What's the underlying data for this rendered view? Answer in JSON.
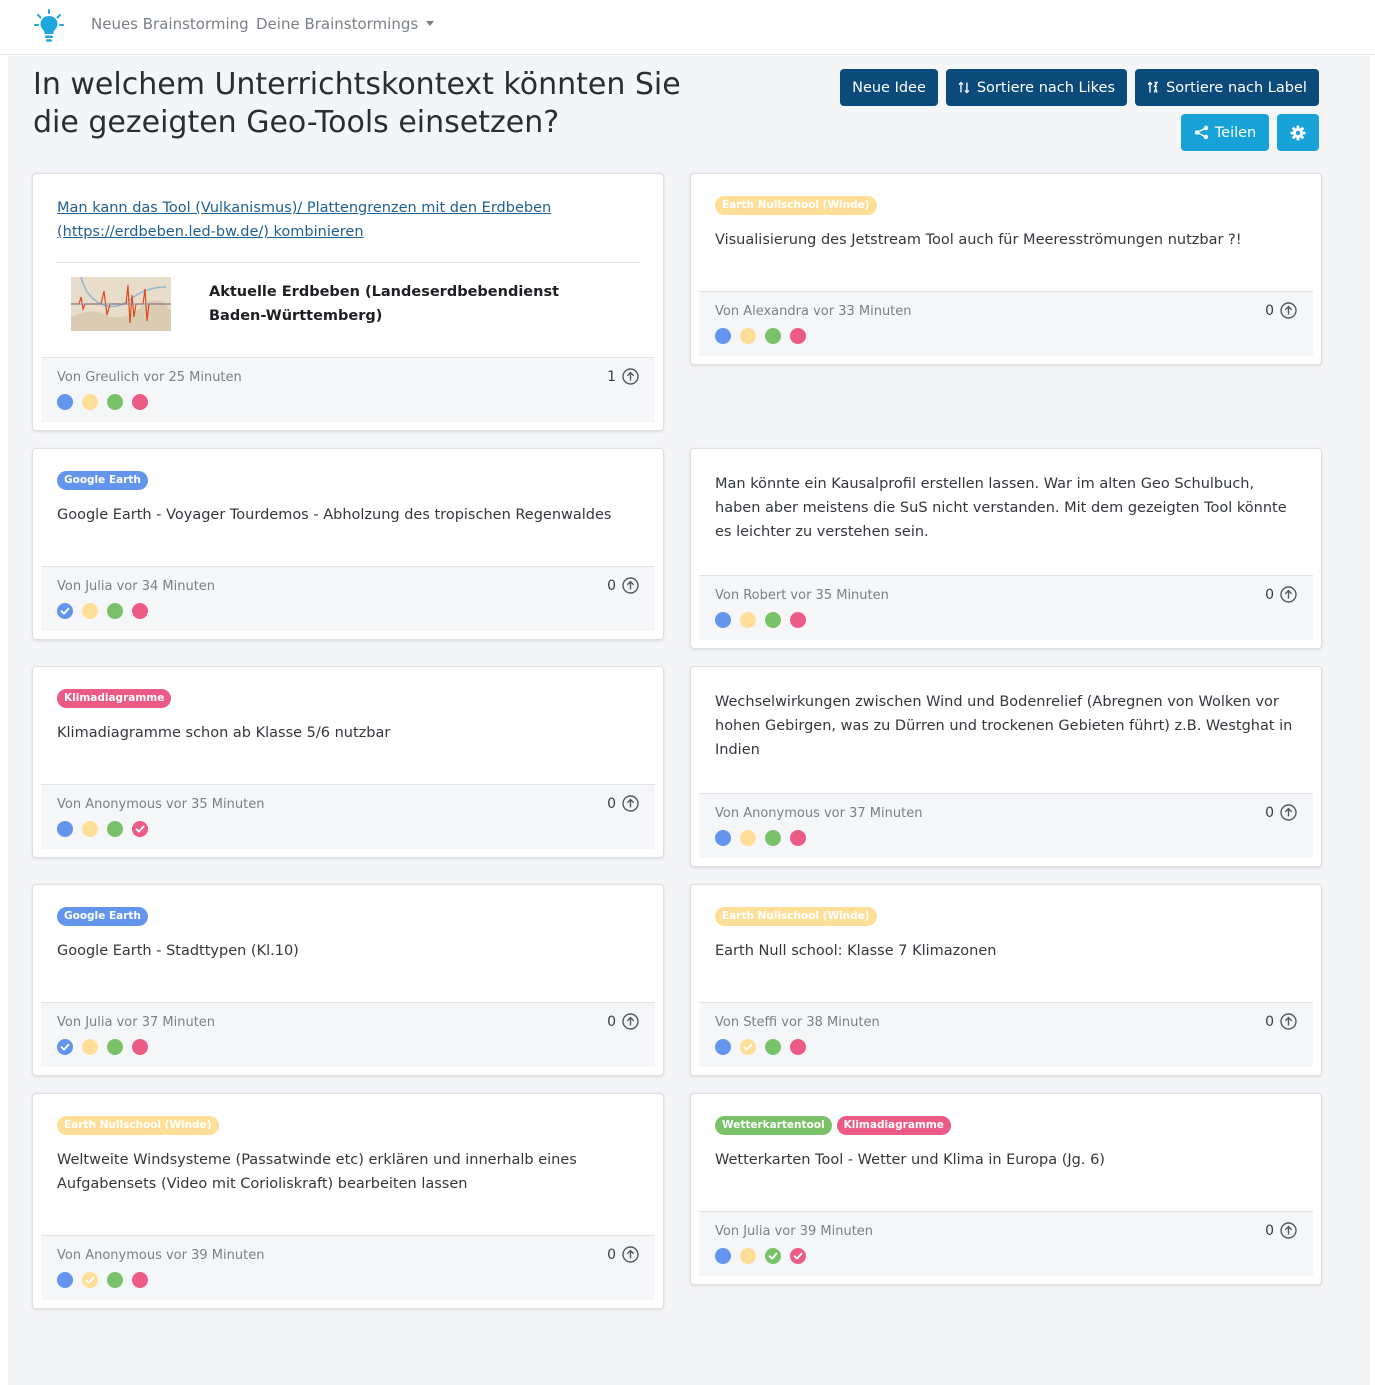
{
  "nav": {
    "new_brainstorming": "Neues Brainstorming",
    "my_brainstormings": "Deine Brainstormings"
  },
  "header": {
    "title": "In welchem Unterrichtskontext könnten Sie die gezeigten Geo-Tools einsetzen?",
    "new_idea": "Neue Idee",
    "sort_likes": "Sortiere nach Likes",
    "sort_label": "Sortiere nach Label",
    "share": "Teilen"
  },
  "colors": {
    "blue": "#6495ed",
    "yellow": "#ffdf97",
    "green": "#7ac26a",
    "pink": "#ec5a86",
    "tag_google_earth": "#6495ed",
    "tag_earth_nullschool": "#ffdf97",
    "tag_klimadiagramme": "#ec5a86",
    "tag_wetterkartentool": "#7ac26a",
    "button_dark": "#0b4a79",
    "button_cyan": "#17a2d8"
  },
  "cards": [
    {
      "tags": [],
      "text": "Man kann das Tool (Vulkanismus)/ Plattengrenzen mit den Erdbeben (https://erdbeben.led-bw.de/) kombinieren",
      "preview_title": "Aktuelle Erdbeben (Landeserdbebendienst Baden-Württemberg)",
      "author": "Von Greulich vor 25 Minuten",
      "likes": "1",
      "checked": [
        false,
        false,
        false,
        false
      ]
    },
    {
      "tags": [
        "Earth Nullschool (Winde)"
      ],
      "text": "Visualisierung des Jetstream Tool auch für Meeresströmungen nutzbar ?!",
      "author": "Von Alexandra vor 33 Minuten",
      "likes": "0",
      "checked": [
        false,
        false,
        false,
        false
      ]
    },
    {
      "tags": [
        "Google Earth"
      ],
      "text": "Google Earth - Voyager Tourdemos - Abholzung des tropischen Regenwaldes",
      "author": "Von Julia vor 34 Minuten",
      "likes": "0",
      "checked": [
        true,
        false,
        false,
        false
      ]
    },
    {
      "tags": [],
      "text": "Man könnte ein Kausalprofil erstellen lassen. War im alten Geo Schulbuch, haben aber meistens die SuS nicht verstanden. Mit dem gezeigten Tool könnte es leichter zu verstehen sein.",
      "author": "Von Robert vor 35 Minuten",
      "likes": "0",
      "checked": [
        false,
        false,
        false,
        false
      ]
    },
    {
      "tags": [
        "Klimadiagramme"
      ],
      "text": "Klimadiagramme schon ab Klasse 5/6 nutzbar",
      "author": "Von Anonymous vor 35 Minuten",
      "likes": "0",
      "checked": [
        false,
        false,
        false,
        true
      ]
    },
    {
      "tags": [],
      "text": "Wechselwirkungen zwischen Wind und Bodenrelief (Abregnen von Wolken vor hohen Gebirgen, was zu Dürren und trockenen Gebieten führt) z.B. Westghat in Indien",
      "author": "Von Anonymous vor 37 Minuten",
      "likes": "0",
      "checked": [
        false,
        false,
        false,
        false
      ]
    },
    {
      "tags": [
        "Google Earth"
      ],
      "text": "Google Earth - Stadttypen (Kl.10)",
      "author": "Von Julia vor 37 Minuten",
      "likes": "0",
      "checked": [
        true,
        false,
        false,
        false
      ]
    },
    {
      "tags": [
        "Earth Nullschool (Winde)"
      ],
      "text": "Earth Null school: Klasse 7 Klimazonen",
      "author": "Von Steffi vor 38 Minuten",
      "likes": "0",
      "checked": [
        false,
        true,
        false,
        false
      ]
    },
    {
      "tags": [
        "Earth Nullschool (Winde)"
      ],
      "text": "Weltweite Windsysteme (Passatwinde etc) erklären und innerhalb eines Aufgabensets (Video mit Corioliskraft) bearbeiten lassen",
      "author": "Von Anonymous vor 39 Minuten",
      "likes": "0",
      "checked": [
        false,
        true,
        false,
        false
      ]
    },
    {
      "tags": [
        "Wetterkartentool",
        "Klimadiagramme"
      ],
      "text": "Wetterkarten Tool - Wetter und Klima in Europa (Jg. 6)",
      "author": "Von Julia vor 39 Minuten",
      "likes": "0",
      "checked": [
        false,
        false,
        true,
        true
      ]
    }
  ]
}
